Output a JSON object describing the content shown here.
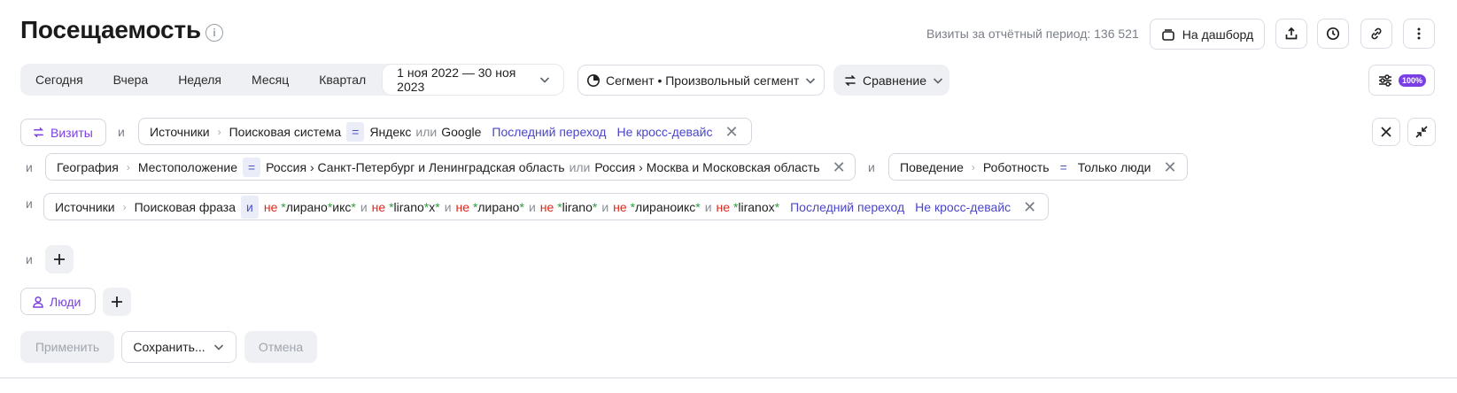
{
  "header": {
    "title": "Посещаемость",
    "info_icon": "i",
    "visits_label": "Визиты за отчётный период: 136 521",
    "dashboard_label": "На дашборд",
    "icons": [
      "dashboard-icon",
      "share-icon",
      "history-icon",
      "link-icon",
      "more-icon"
    ]
  },
  "period": {
    "items": [
      "Сегодня",
      "Вчера",
      "Неделя",
      "Месяц",
      "Квартал"
    ],
    "range": "1 ноя 2022 — 30 ноя 2023"
  },
  "segment": {
    "label": "Сегмент • Произвольный сегмент"
  },
  "comparison": {
    "label": "Сравнение"
  },
  "settings": {
    "badge": "100%"
  },
  "filters": {
    "and": "и",
    "or": "или",
    "visits_tag": "Визиты",
    "people_tag": "Люди",
    "f1": {
      "cat": "Источники",
      "sub": "Поисковая система",
      "op": "=",
      "v1": "Яндекс",
      "v2": "Google",
      "attr": "Последний переход",
      "device": "Не кросс-девайс"
    },
    "f2": {
      "cat": "География",
      "sub": "Местоположение",
      "op": "=",
      "v1": "Россия › Санкт-Петербург и Ленинградская область",
      "v2": "Россия › Москва и Московская область"
    },
    "f3": {
      "cat": "Поведение",
      "sub": "Роботность",
      "op": "=",
      "v1": "Только люди"
    },
    "f4": {
      "cat": "Источники",
      "sub": "Поисковая фраза",
      "op": "и",
      "not": "не",
      "terms": [
        "лирано",
        "икс",
        "lirano",
        "x",
        "лирано",
        "lirano",
        "лираноикс",
        "liranox"
      ],
      "attr": "Последний переход",
      "device": "Не кросс-девайс"
    }
  },
  "actions": {
    "apply": "Применить",
    "save": "Сохранить...",
    "cancel": "Отмена"
  },
  "colors": {
    "accent": "#7b3fe4",
    "link": "#4a45c9",
    "not_red": "#e0261a",
    "star_green": "#2a9d3a"
  }
}
